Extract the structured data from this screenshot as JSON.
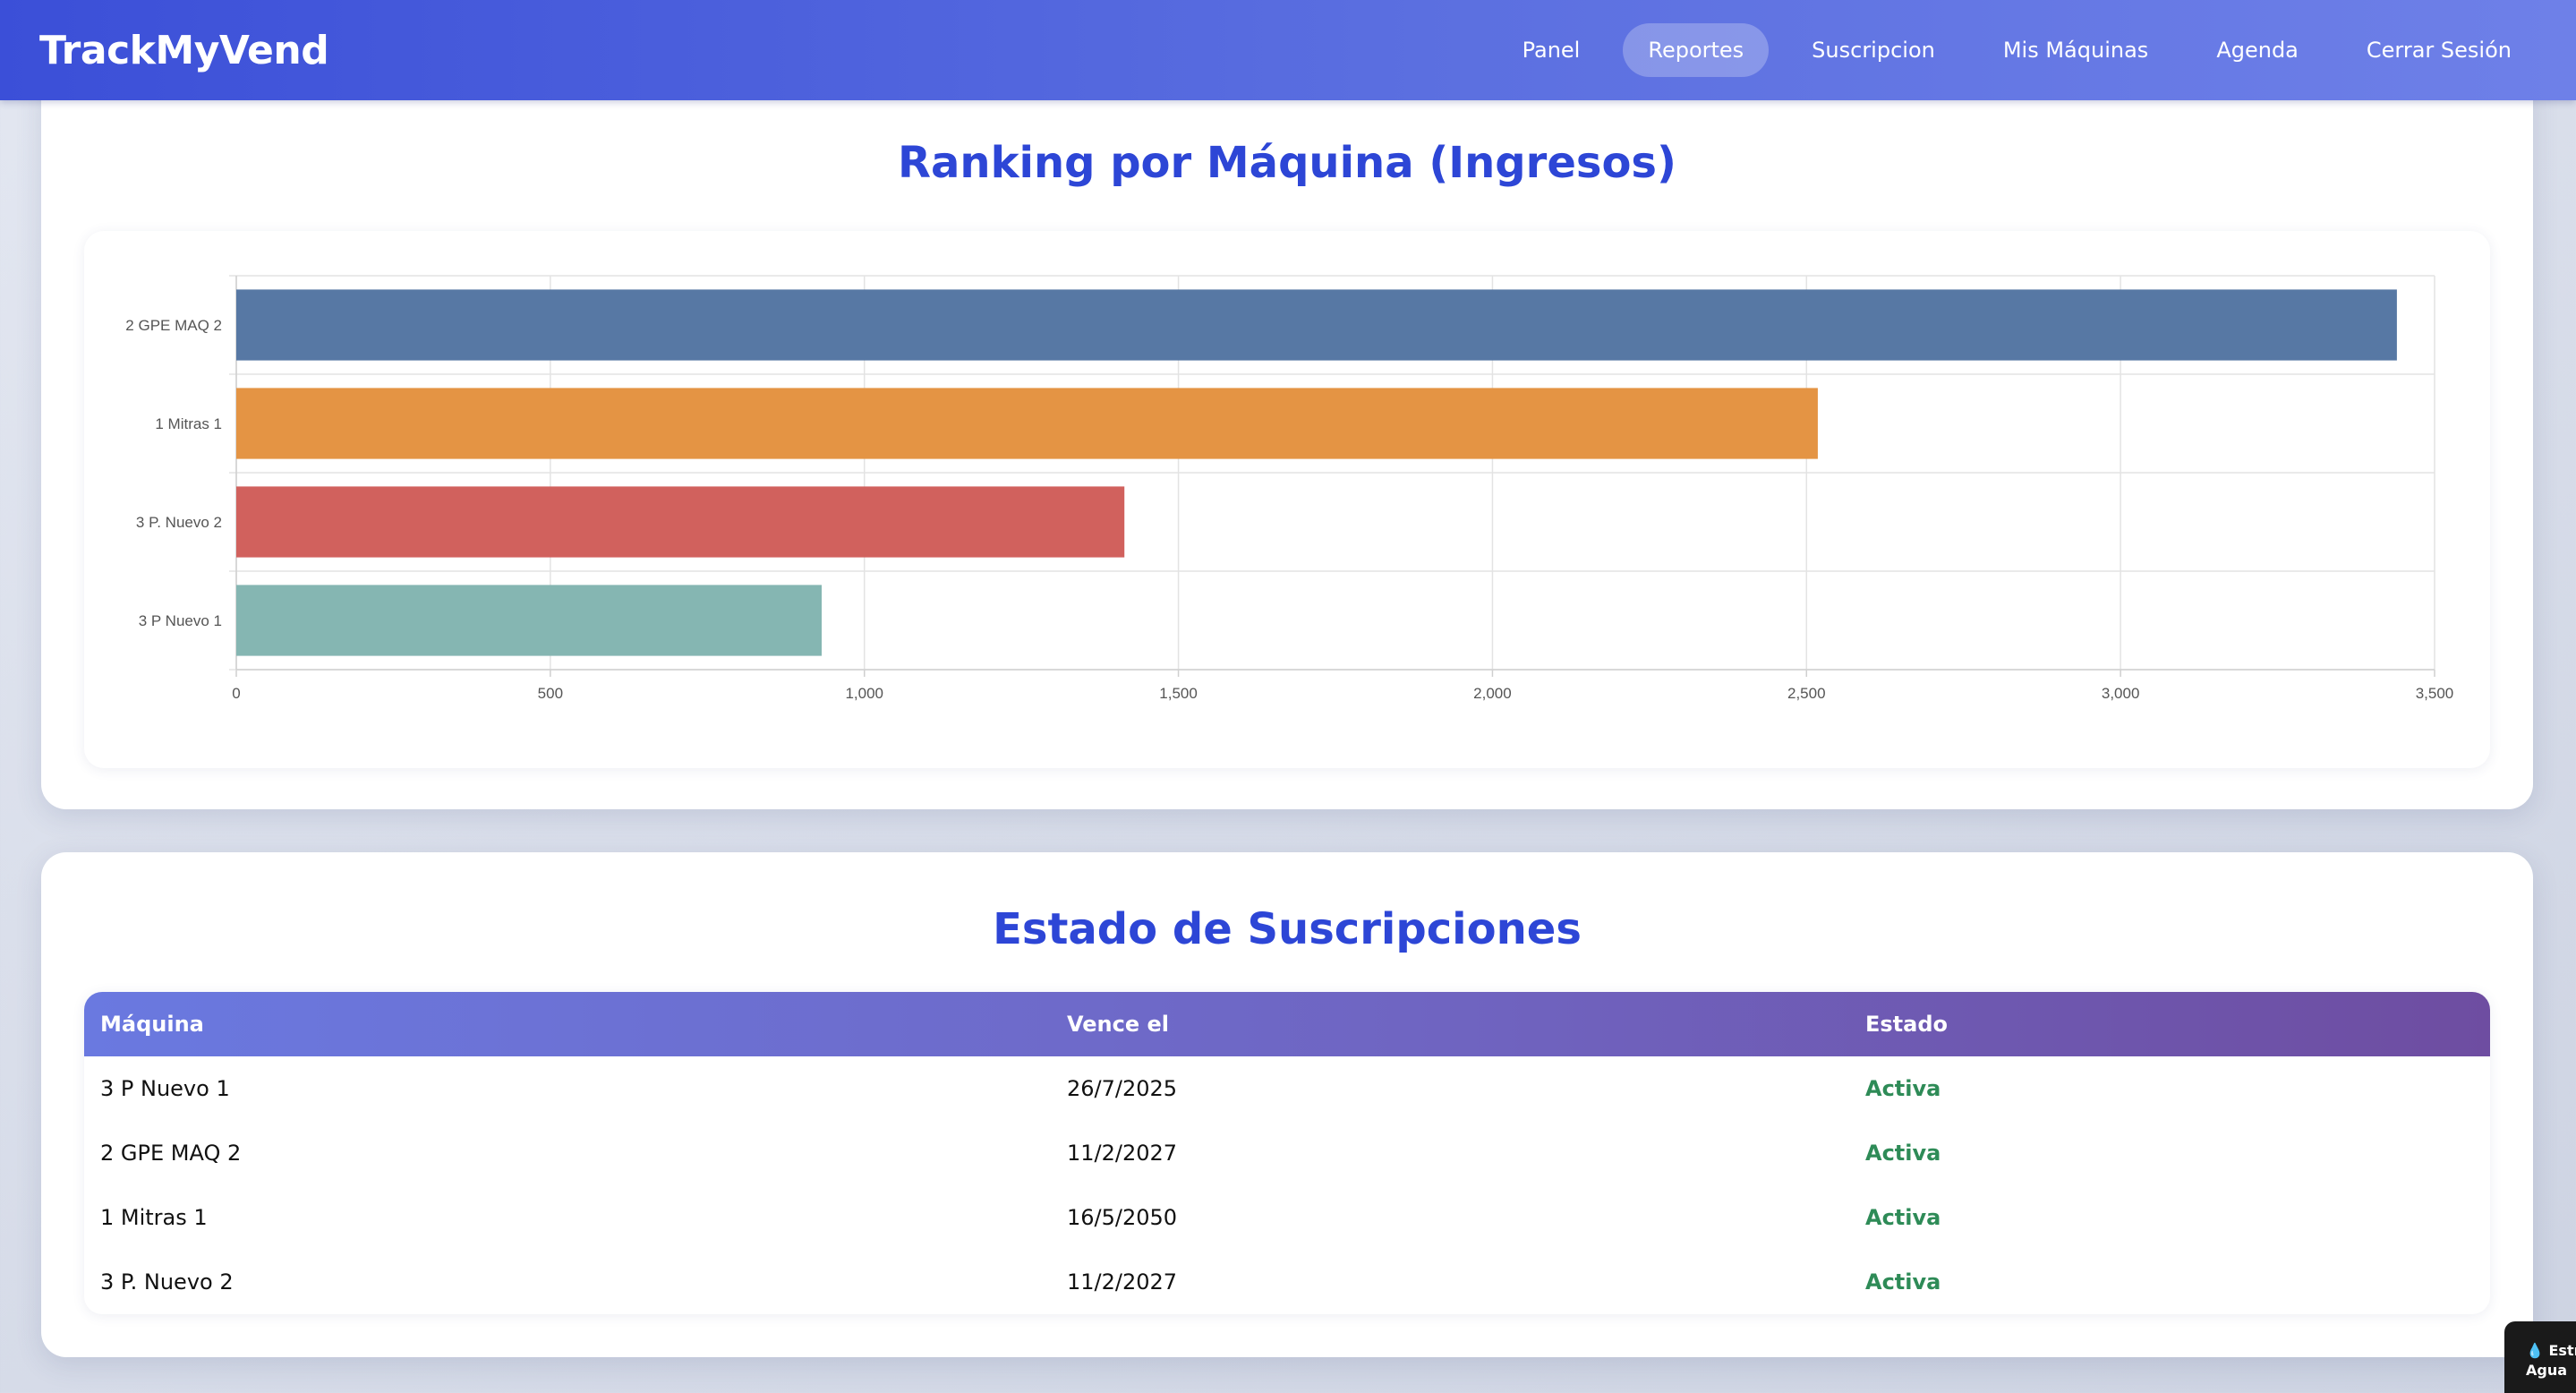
{
  "navbar": {
    "brand": "TrackMyVend",
    "links": [
      {
        "label": "Panel",
        "active": false
      },
      {
        "label": "Reportes",
        "active": true
      },
      {
        "label": "Suscripcion",
        "active": false
      },
      {
        "label": "Mis Máquinas",
        "active": false
      },
      {
        "label": "Agenda",
        "active": false
      },
      {
        "label": "Cerrar Sesión",
        "active": false
      }
    ]
  },
  "ranking": {
    "title": "Ranking por Máquina (Ingresos)"
  },
  "chart_data": {
    "type": "bar",
    "orientation": "horizontal",
    "title": "",
    "xlabel": "",
    "ylabel": "",
    "categories": [
      "2 GPE MAQ 2",
      "1 Mitras 1",
      "3 P. Nuevo 2",
      "3 P Nuevo 1"
    ],
    "values": [
      3440,
      2518,
      1414,
      932
    ],
    "colors": [
      "#5778a4",
      "#e49444",
      "#d1615d",
      "#85b6b2"
    ],
    "xlim": [
      0,
      3500
    ],
    "xticks": [
      0,
      500,
      1000,
      1500,
      2000,
      2500,
      3000,
      3500
    ],
    "xtick_labels": [
      "0",
      "500",
      "1,000",
      "1,500",
      "2,000",
      "2,500",
      "3,000",
      "3,500"
    ],
    "grid": true,
    "legend": "none"
  },
  "subscriptions": {
    "title": "Estado de Suscripciones",
    "columns": [
      "Máquina",
      "Vence el",
      "Estado"
    ],
    "rows": [
      {
        "machine": "3 P Nuevo 1",
        "expires": "26/7/2025",
        "status": "Activa"
      },
      {
        "machine": "2 GPE MAQ 2",
        "expires": "11/2/2027",
        "status": "Activa"
      },
      {
        "machine": "1 Mitras 1",
        "expires": "16/5/2050",
        "status": "Activa"
      },
      {
        "machine": "3 P. Nuevo 2",
        "expires": "11/2/2027",
        "status": "Activa"
      }
    ]
  },
  "widget": {
    "icon": "water-drop-icon",
    "line1": "Estr",
    "line2": "Agua"
  }
}
